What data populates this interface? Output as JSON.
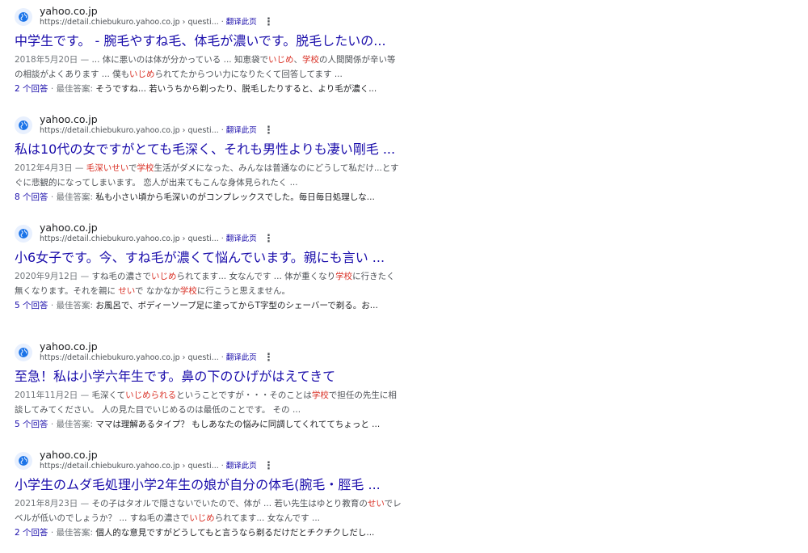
{
  "results": [
    {
      "site": "yahoo.co.jp",
      "url": "https://detail.chiebukuro.yahoo.co.jp › questi...",
      "translate": "翻译此页",
      "title": "中学生です。 - 腕毛やすね毛、体毛が濃いです。脱毛したいの...",
      "snippet": [
        {
          "t": "2018年5月20日 — ",
          "c": "date"
        },
        {
          "t": "... 体に悪いのは体が分かっている ... 知恵袋で",
          "c": ""
        },
        {
          "t": "いじめ",
          "c": "hl"
        },
        {
          "t": "、",
          "c": ""
        },
        {
          "t": "学校",
          "c": "hl"
        },
        {
          "t": "の人間関係が辛い等の相談がよくあります ... 僕も",
          "c": ""
        },
        {
          "t": "いじめ",
          "c": "hl"
        },
        {
          "t": "られてたからつい力になりたくて回答してます ...",
          "c": ""
        }
      ],
      "answer_count": "2 个回答",
      "best_label": " · 最佳答案: ",
      "best_answer": "そうですね... 若いうちから剃ったり、脱毛したりすると、より毛が濃く..."
    },
    {
      "site": "yahoo.co.jp",
      "url": "https://detail.chiebukuro.yahoo.co.jp › questi...",
      "translate": "翻译此页",
      "title": "私は10代の女ですがとても毛深く、それも男性よりも凄い剛毛 ...",
      "snippet": [
        {
          "t": "2012年4月3日 — ",
          "c": "date"
        },
        {
          "t": "毛深いせい",
          "c": "hl"
        },
        {
          "t": "で",
          "c": ""
        },
        {
          "t": "学校",
          "c": "hl"
        },
        {
          "t": "生活がダメになった、みんなは普通なのにどうして私だけ...とすぐに悲観的になってしまいます。 恋人が出来てもこんな身体見られたく ...",
          "c": ""
        }
      ],
      "answer_count": "8 个回答",
      "best_label": " · 最佳答案: ",
      "best_answer": "私も小さい頃から毛深いのがコンプレックスでした。毎日毎日処理しな..."
    },
    {
      "site": "yahoo.co.jp",
      "url": "https://detail.chiebukuro.yahoo.co.jp › questi...",
      "translate": "翻译此页",
      "title": "小6女子です。今、すね毛が濃くて悩んでいます。親にも言い ...",
      "snippet": [
        {
          "t": "2020年9月12日 — ",
          "c": "date"
        },
        {
          "t": "すね毛の濃さで",
          "c": ""
        },
        {
          "t": "いじめ",
          "c": "hl"
        },
        {
          "t": "られてます... 女なんです ... 体が重くなり",
          "c": ""
        },
        {
          "t": "学校",
          "c": "hl"
        },
        {
          "t": "に行きたく無くなります。それを親に ",
          "c": ""
        },
        {
          "t": "せい",
          "c": "hl"
        },
        {
          "t": "で なかなか",
          "c": ""
        },
        {
          "t": "学校",
          "c": "hl"
        },
        {
          "t": "に行こうと思えません。",
          "c": ""
        }
      ],
      "answer_count": "5 个回答",
      "best_label": " · 最佳答案: ",
      "best_answer": "お風呂で、ボディーソープ足に塗ってからT字型のシェーバーで剃る。お..."
    },
    {
      "site": "yahoo.co.jp",
      "url": "https://detail.chiebukuro.yahoo.co.jp › questi...",
      "translate": "翻译此页",
      "title": "至急！私は小学六年生です。鼻の下のひげがはえてきて",
      "snippet": [
        {
          "t": "2011年11月2日 — ",
          "c": "date"
        },
        {
          "t": "毛深くて",
          "c": ""
        },
        {
          "t": "いじめられる",
          "c": "hl"
        },
        {
          "t": "ということですが・・・そのことは",
          "c": ""
        },
        {
          "t": "学校",
          "c": "hl"
        },
        {
          "t": "で担任の先生に相談してみてください。 人の見た目でいじめるのは最低のことです。 その ...",
          "c": ""
        }
      ],
      "answer_count": "5 个回答",
      "best_label": " · 最佳答案: ",
      "best_answer": "ママは理解あるタイプ？ もしあなたの悩みに同調してくれててちょっと ..."
    },
    {
      "site": "yahoo.co.jp",
      "url": "https://detail.chiebukuro.yahoo.co.jp › questi...",
      "translate": "翻译此页",
      "title": "小学生のムダ毛処理小学2年生の娘が自分の体毛(腕毛・脛毛 ...",
      "snippet": [
        {
          "t": "2021年8月23日 — ",
          "c": "date"
        },
        {
          "t": "その子はタオルで隠さないでいたので、体が ... 若い先生はゆとり教育の",
          "c": ""
        },
        {
          "t": "せい",
          "c": "hl"
        },
        {
          "t": "でレベルが低いのでしょうか？ ... すね毛の濃さで",
          "c": ""
        },
        {
          "t": "いじめ",
          "c": "hl"
        },
        {
          "t": "られてます... 女なんです ...",
          "c": ""
        }
      ],
      "answer_count": "2 个回答",
      "best_label": " · 最佳答案: ",
      "best_answer": "個人的な意見ですがどうしてもと言うなら剃るだけだとチクチクしだし..."
    }
  ]
}
